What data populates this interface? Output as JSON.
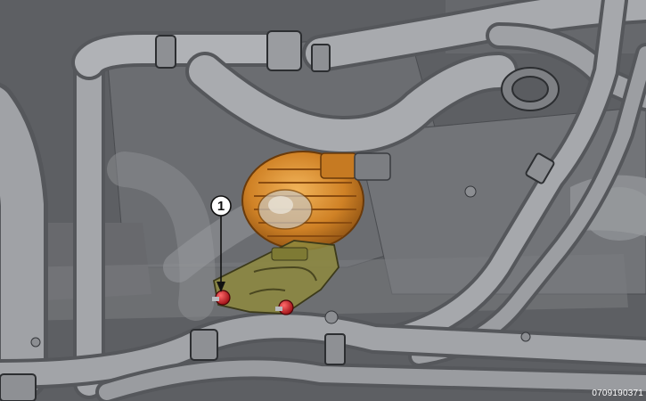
{
  "diagram": {
    "callouts": [
      {
        "number": "1"
      }
    ],
    "figure_id": "0709190371"
  },
  "colors": {
    "background": "#5d5f63",
    "pipe_light": "#a2a4a8",
    "pipe_dark": "#6a6c70",
    "pump_orange": "#d68a2c",
    "bracket_olive": "#8e8a3e",
    "fastener_red": "#d0202a"
  }
}
